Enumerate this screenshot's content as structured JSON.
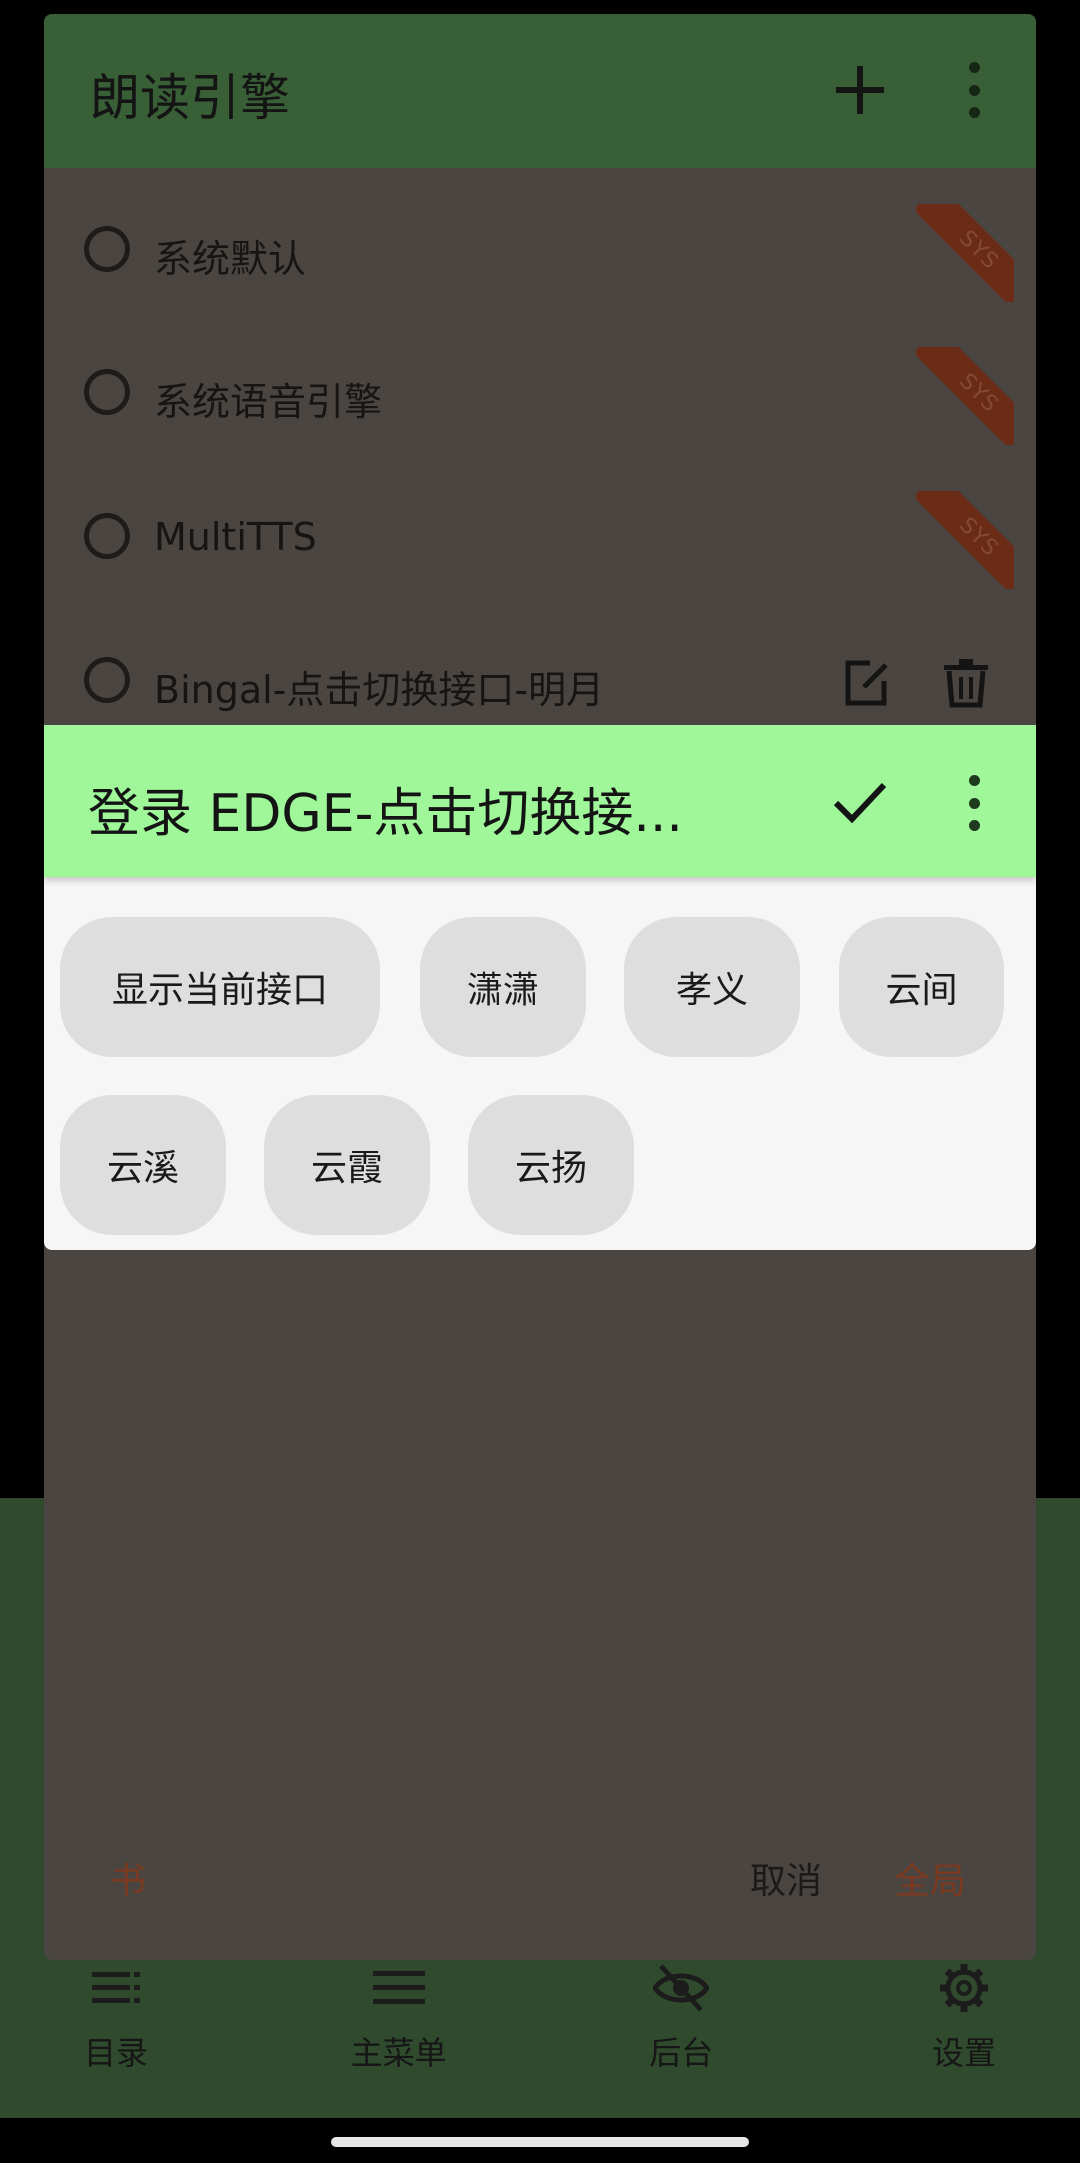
{
  "background": {
    "bottom_nav": [
      {
        "label": "目录",
        "icon": "toc-icon"
      },
      {
        "label": "主菜单",
        "icon": "menu-icon"
      },
      {
        "label": "后台",
        "icon": "eye-off-icon"
      },
      {
        "label": "设置",
        "icon": "gear-icon"
      }
    ]
  },
  "engine_dialog": {
    "title": "朗读引擎",
    "actions": {
      "add_icon": "plus-icon",
      "more_icon": "more-vert-icon"
    },
    "engines": [
      {
        "label": "系统默认",
        "badge": "SYS"
      },
      {
        "label": "系统语音引擎",
        "badge": "SYS"
      },
      {
        "label": "MultiTTS",
        "badge": "SYS"
      },
      {
        "label": "Bingal-点击切换接口-明月",
        "edit_icon": "edit-icon",
        "delete_icon": "trash-icon"
      }
    ],
    "footer": {
      "book": "书",
      "cancel": "取消",
      "global": "全局"
    },
    "colors": {
      "accent_text": "#7a3a22"
    }
  },
  "voice_popup": {
    "title": "登录 EDGE-点击切换接...",
    "actions": {
      "confirm_icon": "check-icon",
      "more_icon": "more-vert-icon"
    },
    "chips": [
      "显示当前接口",
      "潇潇",
      "孝义",
      "云间",
      "云溪",
      "云霞",
      "云扬"
    ],
    "colors": {
      "header": "#9ff79a"
    }
  }
}
